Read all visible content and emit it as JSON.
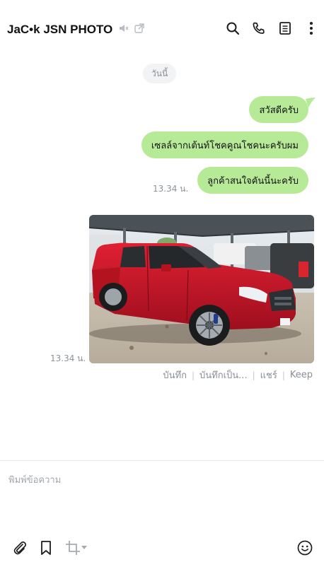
{
  "header": {
    "title": "JaC•k JSN PHOTO",
    "icons": [
      "speaker-muted-icon",
      "popout-icon",
      "search-icon",
      "phone-icon",
      "notes-icon",
      "more-vertical-icon"
    ]
  },
  "chat": {
    "date_label": "วันนี้",
    "messages": [
      {
        "text": "สวัสดีครับ"
      },
      {
        "text": "เซลล์จากเต้นท์โชคคูณโชคนะครับผม"
      },
      {
        "text": "ลูกค้าสนใจคันนี้นะครับ"
      }
    ],
    "text_time": "13.34 น.",
    "photo_time": "13.34 น.",
    "photo_actions": {
      "save": "บันทึก",
      "save_as": "บันทึกเป็น...",
      "share": "แชร์",
      "keep": "Keep"
    }
  },
  "composer": {
    "placeholder": "พิมพ์ข้อความ"
  },
  "colors": {
    "bubble": "#b7ea97",
    "car": "#c8102e"
  }
}
